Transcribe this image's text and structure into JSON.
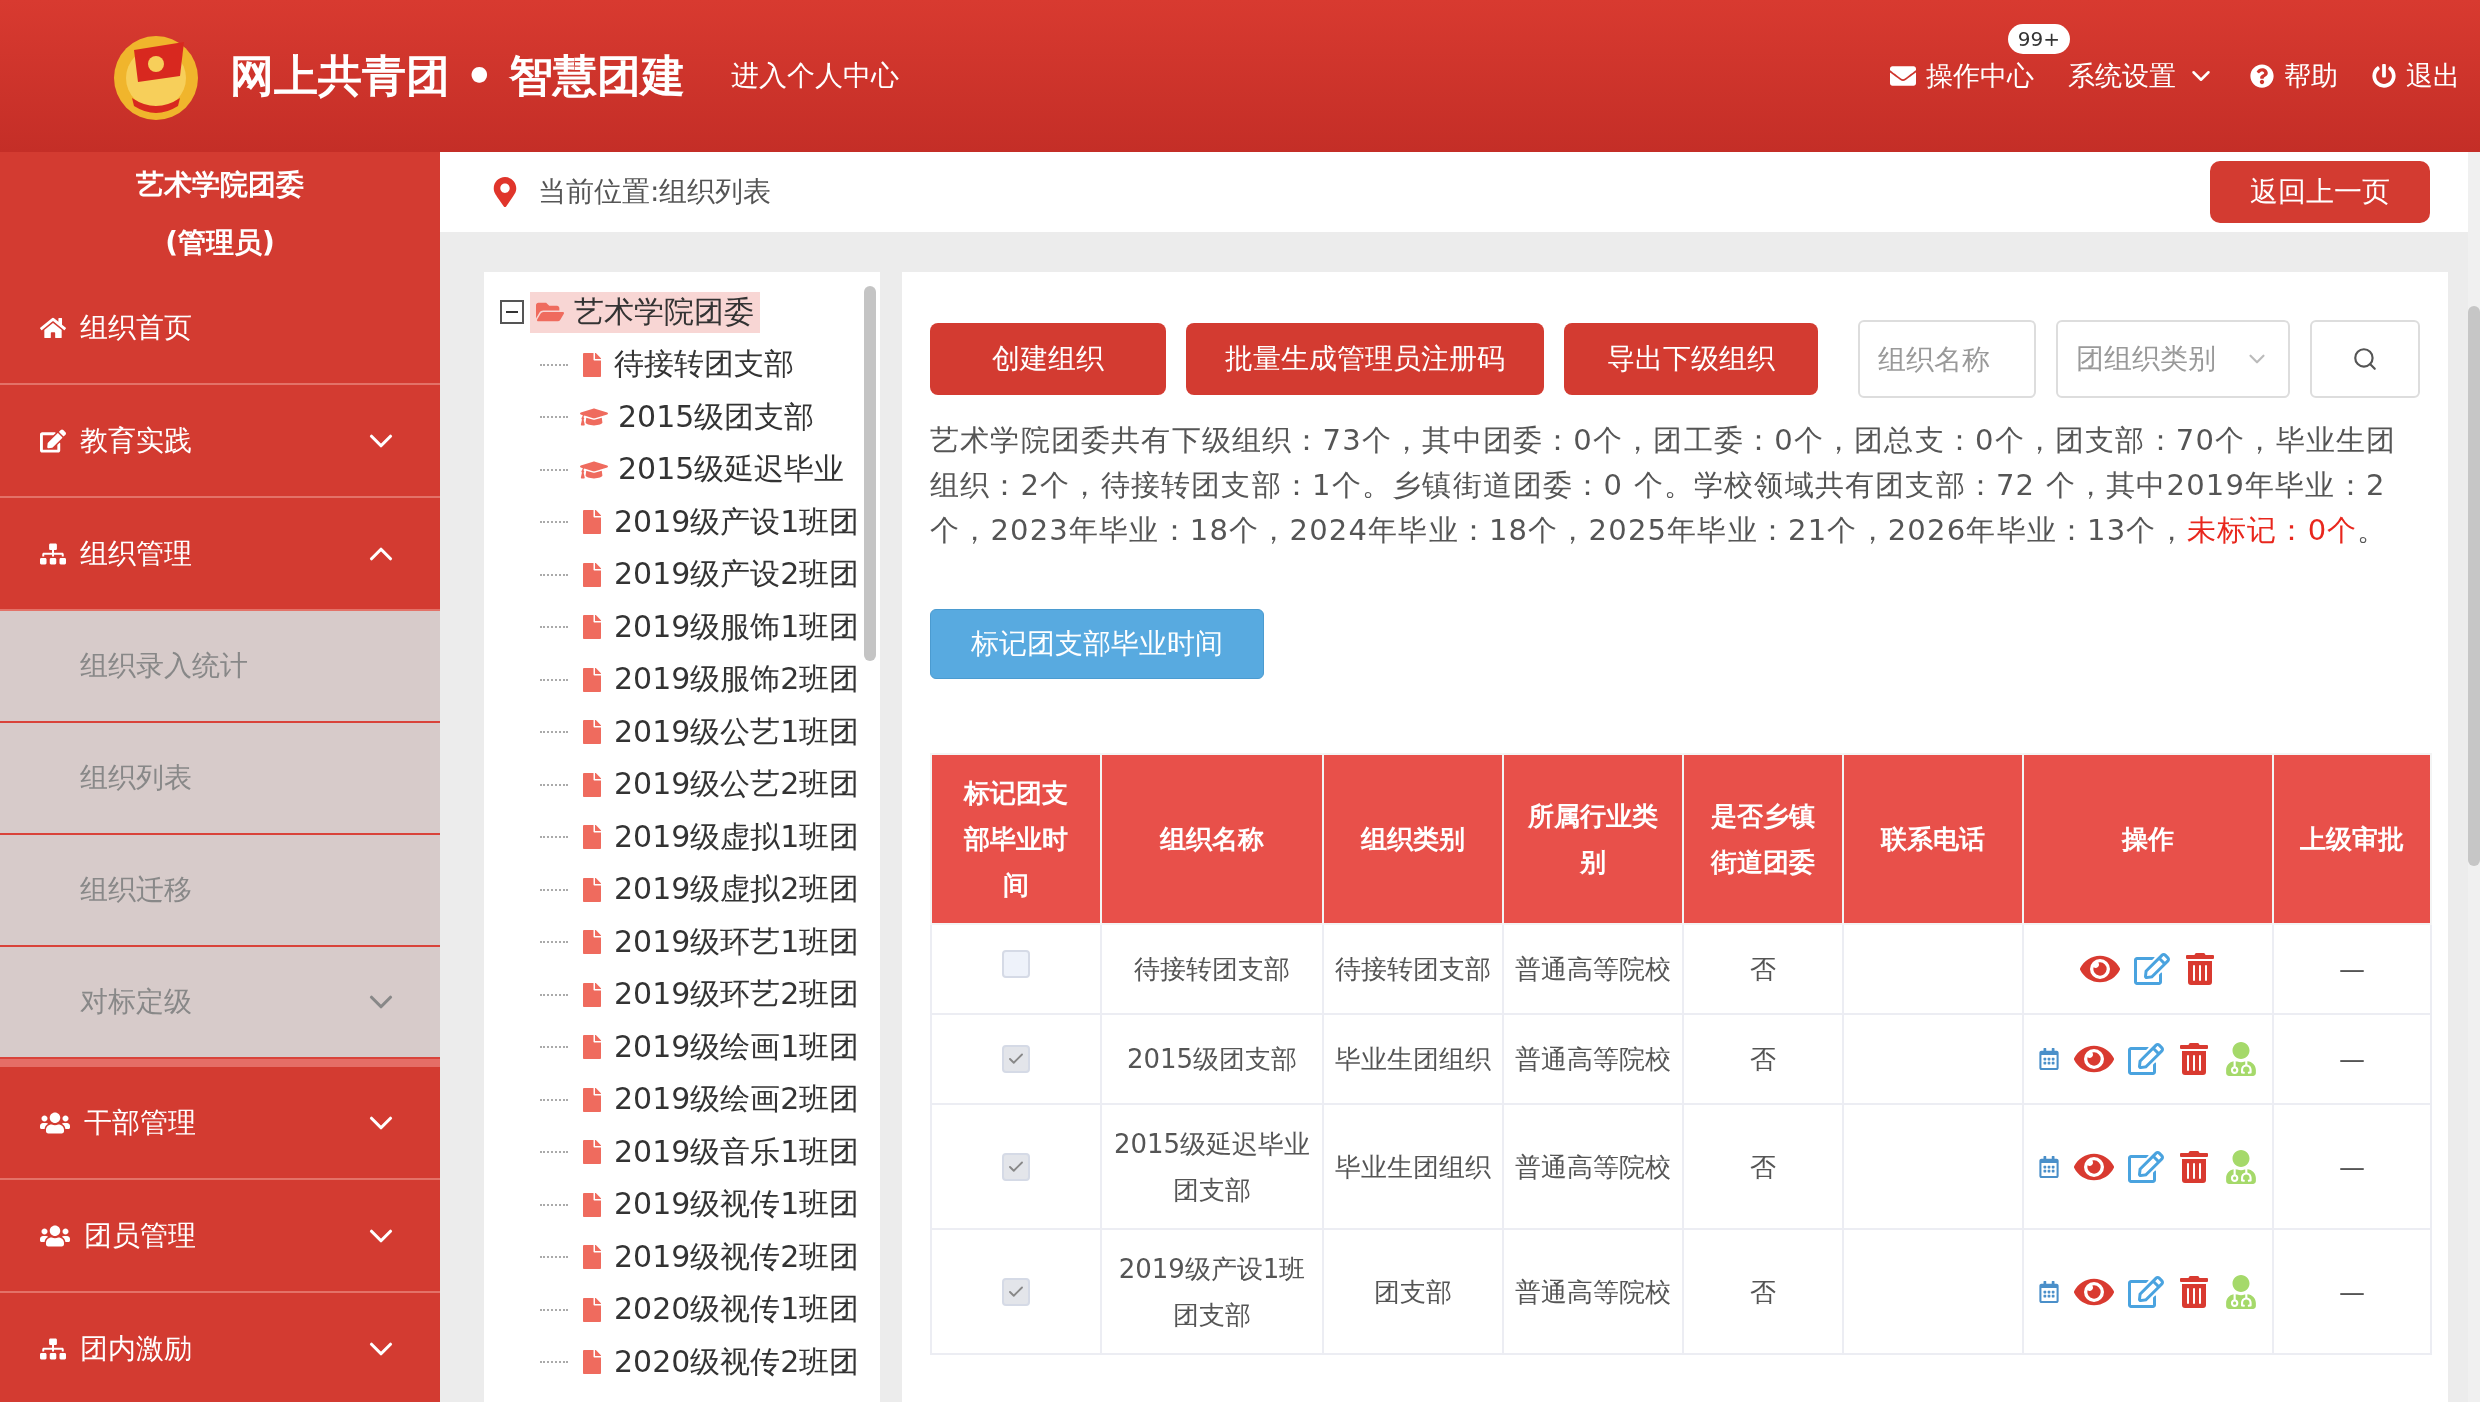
{
  "header": {
    "title": "网上共青团 • 智慧团建",
    "personal_link": "进入个人中心",
    "nav": [
      {
        "kind": "mail",
        "label": "操作中心",
        "badge": "99+"
      },
      {
        "kind": "settings",
        "label": "系统设置"
      },
      {
        "kind": "help",
        "label": "帮助"
      },
      {
        "kind": "logout",
        "label": "退出"
      }
    ]
  },
  "sidebar": {
    "org": "艺术学院团委",
    "role": "(管理员)",
    "items": [
      {
        "kind": "home",
        "label": "组织首页",
        "expandable": false
      },
      {
        "kind": "edit",
        "label": "教育实践",
        "expandable": true
      },
      {
        "kind": "sitemap",
        "label": "组织管理",
        "expandable": true,
        "expanded": true,
        "children": [
          {
            "label": "组织录入统计",
            "expandable": false
          },
          {
            "label": "组织列表",
            "expandable": false
          },
          {
            "label": "组织迁移",
            "expandable": false
          },
          {
            "label": "对标定级",
            "expandable": true
          }
        ]
      },
      {
        "kind": "users",
        "label": "干部管理",
        "expandable": true
      },
      {
        "kind": "users",
        "label": "团员管理",
        "expandable": true
      },
      {
        "kind": "sitemap",
        "label": "团内激励",
        "expandable": true
      }
    ]
  },
  "breadcrumb": "当前位置:组织列表",
  "back_button": "返回上一页",
  "tree": {
    "label": "艺术学院团委",
    "expanded": true,
    "selected": true,
    "children": [
      {
        "kind": "file",
        "label": "待接转团支部"
      },
      {
        "kind": "cap",
        "label": "2015级团支部"
      },
      {
        "kind": "cap",
        "label": "2015级延迟毕业"
      },
      {
        "kind": "file",
        "label": "2019级产设1班团"
      },
      {
        "kind": "file",
        "label": "2019级产设2班团"
      },
      {
        "kind": "file",
        "label": "2019级服饰1班团"
      },
      {
        "kind": "file",
        "label": "2019级服饰2班团"
      },
      {
        "kind": "file",
        "label": "2019级公艺1班团"
      },
      {
        "kind": "file",
        "label": "2019级公艺2班团"
      },
      {
        "kind": "file",
        "label": "2019级虚拟1班团"
      },
      {
        "kind": "file",
        "label": "2019级虚拟2班团"
      },
      {
        "kind": "file",
        "label": "2019级环艺1班团"
      },
      {
        "kind": "file",
        "label": "2019级环艺2班团"
      },
      {
        "kind": "file",
        "label": "2019级绘画1班团"
      },
      {
        "kind": "file",
        "label": "2019级绘画2班团"
      },
      {
        "kind": "file",
        "label": "2019级音乐1班团"
      },
      {
        "kind": "file",
        "label": "2019级视传1班团"
      },
      {
        "kind": "file",
        "label": "2019级视传2班团"
      },
      {
        "kind": "file",
        "label": "2020级视传1班团"
      },
      {
        "kind": "file",
        "label": "2020级视传2班团"
      }
    ]
  },
  "actions": [
    "创建组织",
    "批量生成管理员注册码",
    "导出下级组织"
  ],
  "filters": {
    "name_placeholder": "组织名称",
    "type_placeholder": "团组织类别"
  },
  "summary": [
    {
      "text": "艺术学院团委共有下级组织：73个，其中团委：0个，团工委：0个，团总支：0个，团支部：70个，毕业生团组织：2个，待接转团支部：1个。乡镇街道团委：0 个。学校领域共有团支部：72 个，其中2019年毕业：2个，2023年毕业：18个，2024年毕业：18个，2025年毕业：21个，2026年毕业：13个，",
      "highlight": false
    },
    {
      "text": "未标记：0个",
      "highlight": true
    },
    {
      "text": "。",
      "highlight": false
    }
  ],
  "mark_button": "标记团支部毕业时间",
  "table": {
    "columns": [
      "标记团支部毕业时间",
      "组织名称",
      "组织类别",
      "所属行业类别",
      "是否乡镇街道团委",
      "联系电话",
      "操作",
      "上级审批"
    ],
    "rows": [
      {
        "checked": false,
        "disabled": false,
        "name": "待接转团支部",
        "type": "待接转团支部",
        "industry": "普通高等院校",
        "township": "否",
        "approval": "—",
        "ops": [
          {
            "kind": "view"
          },
          {
            "kind": "edit"
          },
          {
            "kind": "delete"
          }
        ]
      },
      {
        "checked": true,
        "disabled": true,
        "name": "2015级团支部",
        "type": "毕业生团组织",
        "industry": "普通高等院校",
        "township": "否",
        "approval": "—",
        "ops": [
          {
            "kind": "calendar"
          },
          {
            "kind": "view"
          },
          {
            "kind": "edit"
          },
          {
            "kind": "delete"
          },
          {
            "kind": "person"
          }
        ]
      },
      {
        "checked": true,
        "disabled": true,
        "name": "2015级延迟毕业团支部",
        "type": "毕业生团组织",
        "industry": "普通高等院校",
        "township": "否",
        "approval": "—",
        "ops": [
          {
            "kind": "calendar"
          },
          {
            "kind": "view"
          },
          {
            "kind": "edit"
          },
          {
            "kind": "delete"
          },
          {
            "kind": "person"
          }
        ]
      },
      {
        "checked": true,
        "disabled": true,
        "name": "2019级产设1班团支部",
        "type": "团支部",
        "industry": "普通高等院校",
        "township": "否",
        "approval": "—",
        "ops": [
          {
            "kind": "calendar"
          },
          {
            "kind": "view"
          },
          {
            "kind": "edit"
          },
          {
            "kind": "delete"
          },
          {
            "kind": "person"
          }
        ]
      }
    ]
  }
}
